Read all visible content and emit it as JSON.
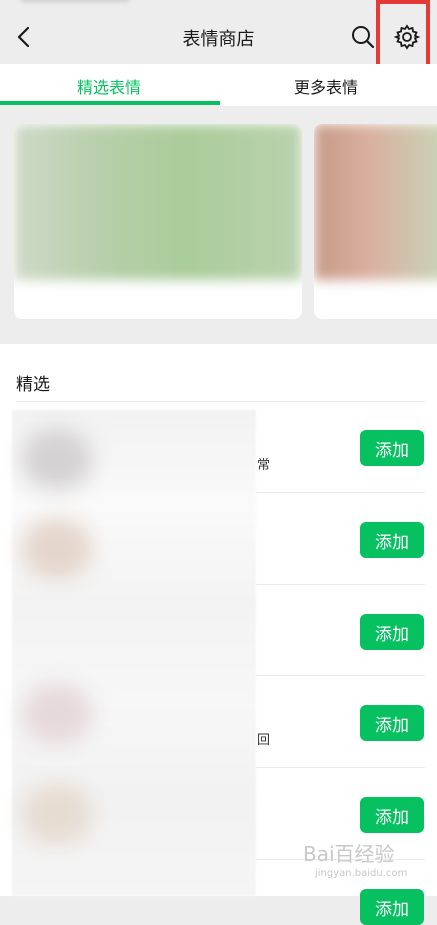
{
  "header": {
    "title": "表情商店"
  },
  "tabs": [
    {
      "label": "精选表情",
      "active": true
    },
    {
      "label": "更多表情",
      "active": false
    }
  ],
  "section": {
    "title": "精选"
  },
  "items": [
    {
      "fragment": "常",
      "add_label": "添加"
    },
    {
      "fragment": "",
      "add_label": "添加"
    },
    {
      "fragment": "",
      "add_label": "添加"
    },
    {
      "fragment": "回",
      "add_label": "添加"
    },
    {
      "fragment": "",
      "add_label": "添加"
    },
    {
      "fragment": "",
      "add_label": "添加"
    }
  ],
  "watermark": {
    "text": "Bai百经验",
    "sub": "jingyan.baidu.com"
  },
  "colors": {
    "accent": "#07c160",
    "highlight": "#e53935"
  },
  "icons": {
    "back": "chevron-left-icon",
    "search": "search-icon",
    "settings": "gear-icon"
  }
}
